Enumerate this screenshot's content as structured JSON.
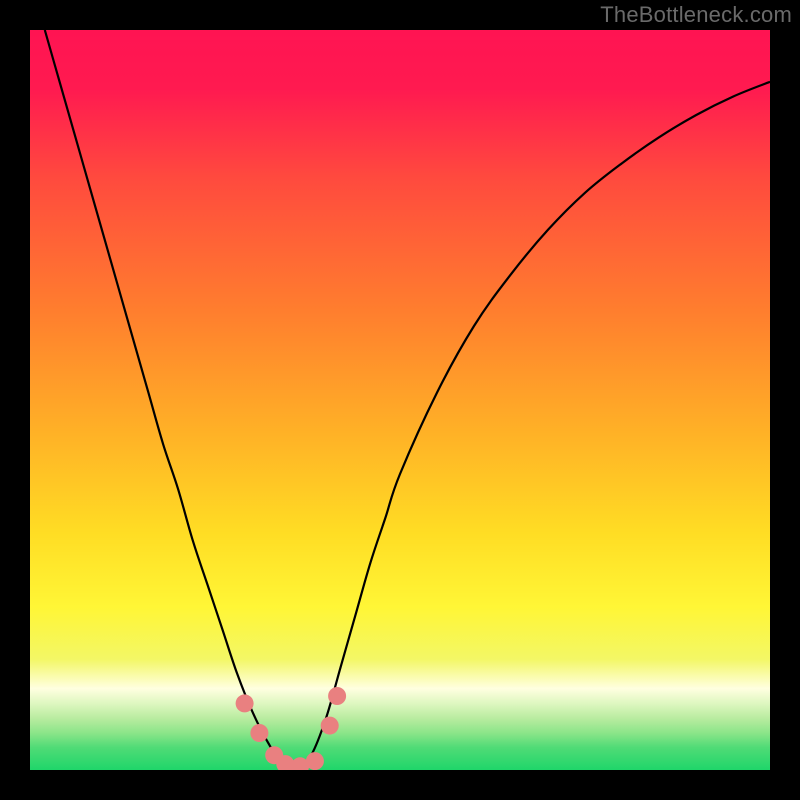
{
  "watermark": "TheBottleneck.com",
  "colors": {
    "frame": "#000000",
    "watermark_text": "#6a6a6a",
    "marker_fill": "#e98080",
    "marker_stroke": "#c95b5b",
    "curve_stroke": "#000000",
    "green_band": "#1fd66a",
    "pale_green": "#b9eca0",
    "yellow": "#fff32a",
    "orange": "#ffa225",
    "red_orange": "#ff5a35",
    "pink_red": "#ff1452"
  },
  "chart_data": {
    "type": "line",
    "title": "",
    "xlabel": "",
    "ylabel": "",
    "xlim": [
      0,
      100
    ],
    "ylim": [
      0,
      100
    ],
    "x": [
      0,
      2,
      4,
      6,
      8,
      10,
      12,
      14,
      16,
      18,
      20,
      22,
      24,
      26,
      28,
      30,
      32,
      34,
      36,
      38,
      40,
      42,
      44,
      46,
      48,
      50,
      55,
      60,
      65,
      70,
      75,
      80,
      85,
      90,
      95,
      100
    ],
    "values": [
      null,
      100,
      93,
      86,
      79,
      72,
      65,
      58,
      51,
      44,
      38,
      31,
      25,
      19,
      13,
      8,
      4,
      1,
      0,
      2,
      7,
      14,
      21,
      28,
      34,
      40,
      51,
      60,
      67,
      73,
      78,
      82,
      85.5,
      88.5,
      91,
      93
    ],
    "markers": [
      {
        "x": 29,
        "y": 9
      },
      {
        "x": 31,
        "y": 5
      },
      {
        "x": 33,
        "y": 2
      },
      {
        "x": 34.5,
        "y": 0.8
      },
      {
        "x": 36.5,
        "y": 0.5
      },
      {
        "x": 38.5,
        "y": 1.2
      },
      {
        "x": 40.5,
        "y": 6
      },
      {
        "x": 41.5,
        "y": 10
      }
    ]
  }
}
